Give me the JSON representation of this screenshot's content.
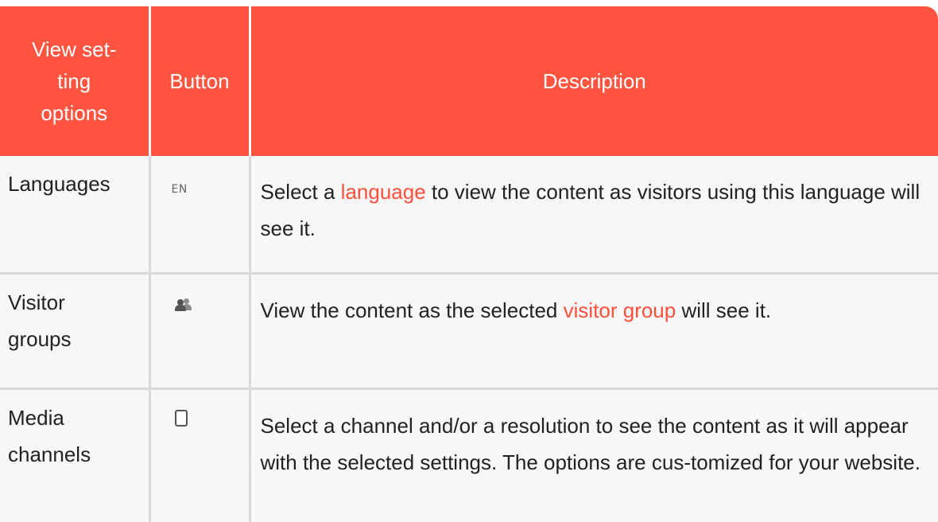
{
  "table": {
    "headers": {
      "option": "View set-ting options",
      "button": "Button",
      "description": "Description"
    },
    "header_lines": [
      "View set-",
      "ting",
      "options"
    ],
    "rows": [
      {
        "option_lines": [
          "Languages"
        ],
        "button_icon": "language-icon",
        "button_text": "EN",
        "desc_before": "Select a ",
        "desc_link": "language",
        "desc_after": " to view the content as visitors using this language will see it."
      },
      {
        "option_lines": [
          "Visitor",
          "groups"
        ],
        "button_icon": "visitor-groups-icon",
        "desc_before": "View the content as the selected ",
        "desc_link": "visitor group",
        "desc_after": " will see it."
      },
      {
        "option_lines": [
          "Media",
          "channels"
        ],
        "button_icon": "mobile-device-icon",
        "desc_before": "Select a channel and/or a resolution to see the content as it will appear with the selected settings. The options are cus-tomized for your website."
      }
    ]
  },
  "colors": {
    "header_bg": "#ff5540",
    "link": "#ff4f3a",
    "body_bg": "#f7f7f7"
  }
}
